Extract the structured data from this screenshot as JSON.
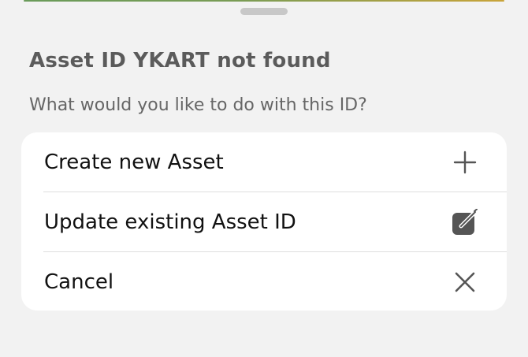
{
  "dialog": {
    "title": "Asset ID YKART not found",
    "subtitle": "What would you like to do with this ID?"
  },
  "actions": [
    {
      "label": "Create new Asset",
      "icon": "plus-icon"
    },
    {
      "label": "Update existing Asset ID",
      "icon": "edit-square-icon"
    },
    {
      "label": "Cancel",
      "icon": "close-icon"
    }
  ],
  "colors": {
    "background": "#f2f2f2",
    "card": "#ffffff",
    "title_text": "#5b5b5b",
    "item_text": "#111111",
    "icon": "#555555"
  }
}
